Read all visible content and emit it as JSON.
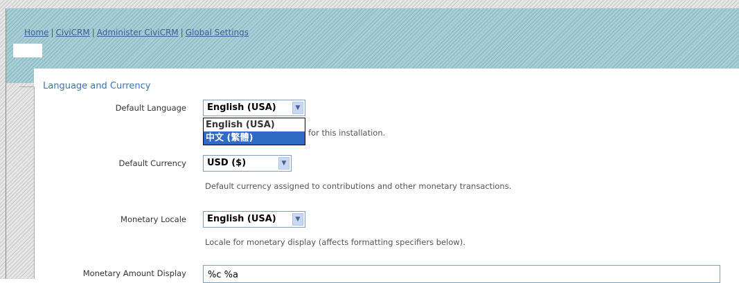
{
  "breadcrumb": {
    "items": [
      "Home",
      "CiviCRM",
      "Administer CiviCRM",
      "Global Settings"
    ]
  },
  "section": {
    "legend": "Language and Currency"
  },
  "fields": {
    "default_language": {
      "label": "Default Language",
      "value": "English (USA)",
      "help": "for this installation.",
      "options": [
        "English (USA)",
        "中文 (繁體)"
      ],
      "highlighted_option": "中文 (繁體)"
    },
    "default_currency": {
      "label": "Default Currency",
      "value": "USD ($)",
      "help": "Default currency assigned to contributions and other monetary transactions."
    },
    "monetary_locale": {
      "label": "Monetary Locale",
      "value": "English (USA)",
      "help": "Locale for monetary display (affects formatting specifiers below)."
    },
    "monetary_amount_display": {
      "label": "Monetary Amount Display",
      "value": "%c %a"
    }
  },
  "icons": {
    "dropdown_arrow": "chevron-down-icon"
  },
  "colors": {
    "link": "#3a5f9a",
    "legend": "#3a73b8",
    "header_teal": "#9ec7cf",
    "selection": "#316ac5"
  }
}
